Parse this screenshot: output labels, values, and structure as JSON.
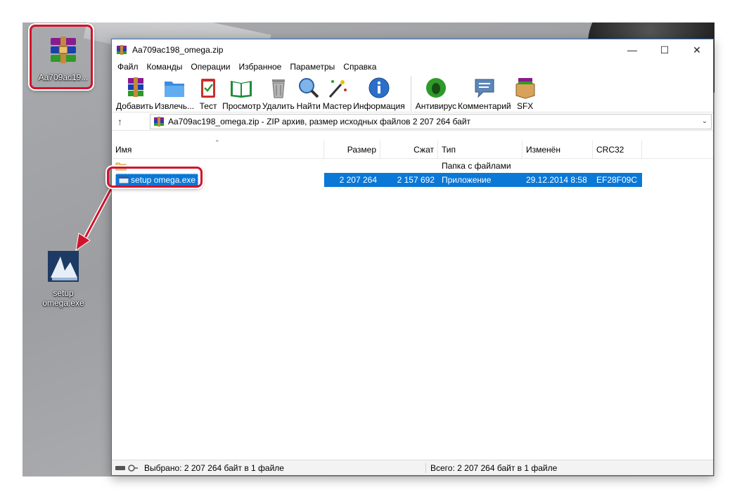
{
  "window": {
    "title": "Aa709ac198_omega.zip"
  },
  "menu": [
    "Файл",
    "Команды",
    "Операции",
    "Избранное",
    "Параметры",
    "Справка"
  ],
  "toolbar": {
    "add": "Добавить",
    "extract": "Извлечь...",
    "test": "Тест",
    "view": "Просмотр",
    "delete": "Удалить",
    "find": "Найти",
    "wizard": "Мастер",
    "info": "Информация",
    "antivirus": "Антивирус",
    "comment": "Комментарий",
    "sfx": "SFX"
  },
  "address": {
    "text": "Aa709ac198_omega.zip - ZIP архив, размер исходных файлов 2 207 264 байт"
  },
  "columns": {
    "name": "Имя",
    "size": "Размер",
    "packed": "Сжат",
    "type": "Тип",
    "modified": "Изменён",
    "crc": "CRC32"
  },
  "rows": [
    {
      "name": "",
      "size": "",
      "packed": "",
      "type": "Папка с файлами",
      "modified": "",
      "crc": ""
    },
    {
      "name": "setup omega.exe",
      "size": "2 207 264",
      "packed": "2 157 692",
      "type": "Приложение",
      "modified": "29.12.2014 8:58",
      "crc": "EF28F09C"
    }
  ],
  "status": {
    "selected": "Выбрано: 2 207 264 байт в 1 файле",
    "total": "Всего: 2 207 264 байт в 1 файле"
  },
  "desktop": {
    "archive_icon_label": "Aa709ac19...",
    "setup_icon_label": "setup omega.exe"
  },
  "colors": {
    "highlight": "#d0142c",
    "selection": "#0a78d7"
  }
}
